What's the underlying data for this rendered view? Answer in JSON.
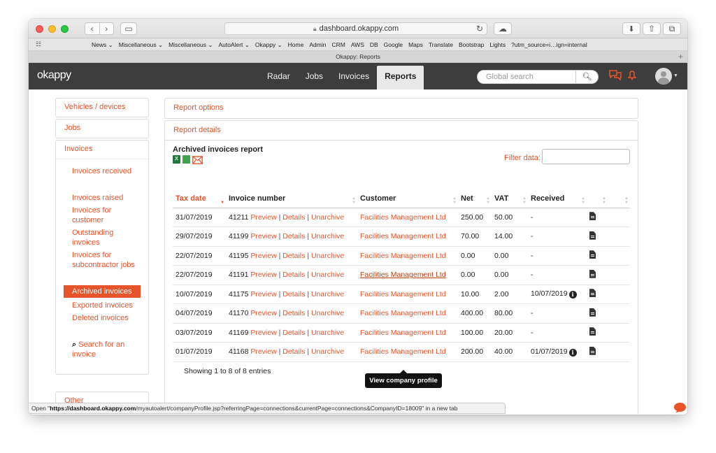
{
  "browser": {
    "url": "dashboard.okappy.com",
    "tab_title": "Okappy: Reports",
    "favorites": [
      "News ⌄",
      "Miscellaneous ⌄",
      "Miscellaneous ⌄",
      "AutoAlert ⌄",
      "Okappy ⌄",
      "Home",
      "Admin",
      "CRM",
      "AWS",
      "DB",
      "Google",
      "Maps",
      "Translate",
      "Bootstrap",
      "Lights",
      "?utm_source=i…ign=internal"
    ],
    "status_prefix": "Open \"",
    "status_bold": "https://dashboard.okappy.com",
    "status_rest": "/myautoalert/companyProfile.jsp?referringPage=connections&currentPage=connections&CompanyID=18009\" in a new tab"
  },
  "app": {
    "logo": "okappy",
    "nav": {
      "radar": "Radar",
      "jobs": "Jobs",
      "invoices": "Invoices",
      "reports": "Reports"
    },
    "search_placeholder": "Global search"
  },
  "sidebar": {
    "vehicles": "Vehicles / devices",
    "jobs": "Jobs",
    "invoices": "Invoices",
    "items": {
      "received": "Invoices received",
      "raised": "Invoices raised",
      "for_customer": "Invoices for customer",
      "outstanding": "Outstanding invoices",
      "subcontractor": "Invoices for subcontractor jobs",
      "archived": "Archived invoices",
      "exported": "Exported invoices",
      "deleted": "Deleted invoices",
      "search": "Search for an invoice"
    },
    "other": "Other"
  },
  "report": {
    "options": "Report options",
    "details": "Report details",
    "title": "Archived invoices report",
    "filter_label": "Filter data:",
    "columns": [
      "Tax date",
      "Invoice number",
      "Customer",
      "Net",
      "VAT",
      "Received",
      "",
      ""
    ],
    "action_labels": {
      "preview": "Preview",
      "details": "Details",
      "unarchive": "Unarchive",
      "sep": "|"
    },
    "rows": [
      {
        "date": "31/07/2019",
        "number": "41211",
        "customer": "Facilities Management Ltd",
        "net": "250.00",
        "vat": "50.00",
        "received": "-"
      },
      {
        "date": "29/07/2019",
        "number": "41199",
        "customer": "Facilities Management Ltd",
        "net": "70.00",
        "vat": "14.00",
        "received": "-"
      },
      {
        "date": "22/07/2019",
        "number": "41195",
        "customer": "Facilities Management Ltd",
        "net": "0.00",
        "vat": "0.00",
        "received": "-"
      },
      {
        "date": "22/07/2019",
        "number": "41191",
        "customer": "Facilities Management Ltd",
        "net": "0.00",
        "vat": "0.00",
        "received": "-"
      },
      {
        "date": "10/07/2019",
        "number": "41175",
        "customer": "Facilities Management Ltd",
        "net": "10.00",
        "vat": "2.00",
        "received": "10/07/2019"
      },
      {
        "date": "04/07/2019",
        "number": "41170",
        "customer": "Facilities Management Ltd",
        "net": "400.00",
        "vat": "80.00",
        "received": "-"
      },
      {
        "date": "03/07/2019",
        "number": "41169",
        "customer": "Facilities Management Ltd",
        "net": "100.00",
        "vat": "20.00",
        "received": "-"
      },
      {
        "date": "01/07/2019",
        "number": "41168",
        "customer": "Facilities Management Ltd",
        "net": "200.00",
        "vat": "40.00",
        "received": "01/07/2019"
      }
    ],
    "showing": "Showing 1 to 8 of 8 entries",
    "tooltip": "View company profile"
  },
  "colors": {
    "accent": "#e8542a",
    "nav_bg": "#3d3d3d"
  }
}
